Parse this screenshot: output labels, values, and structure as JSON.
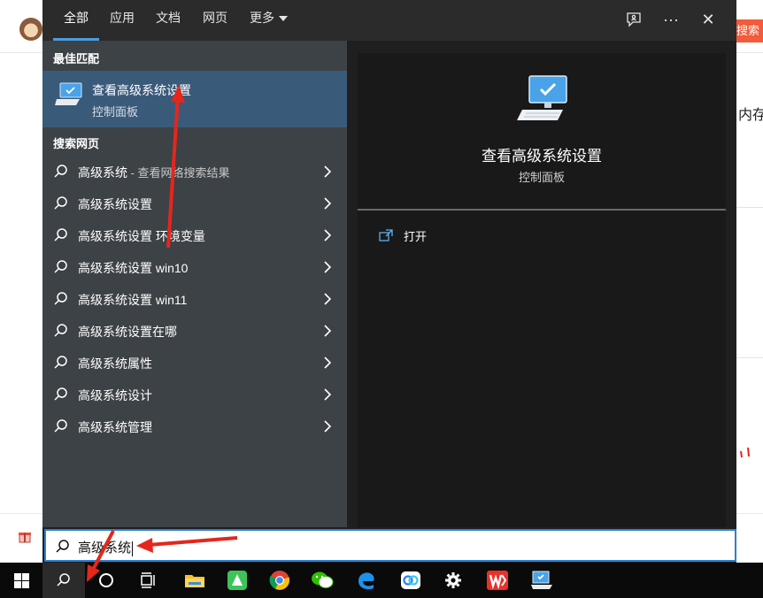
{
  "background_page": {
    "search_button_label": "搜索",
    "side_text": "内存"
  },
  "tabs": [
    {
      "label": "全部",
      "active": true
    },
    {
      "label": "应用"
    },
    {
      "label": "文档"
    },
    {
      "label": "网页"
    },
    {
      "label": "更多"
    }
  ],
  "header_icons": [
    "feedback-icon",
    "more-options-icon",
    "close-icon"
  ],
  "header_ellipsis": "···",
  "header_close": "✕",
  "best_match": {
    "section_label": "最佳匹配",
    "title": "查看高级系统设置",
    "subtitle": "控制面板"
  },
  "web_search": {
    "section_label": "搜索网页",
    "items": [
      {
        "text": "高级系统",
        "suffix": " - 查看网络搜索结果"
      },
      {
        "text": "高级系统设置"
      },
      {
        "text": "高级系统设置 环境变量"
      },
      {
        "text": "高级系统设置 win10"
      },
      {
        "text": "高级系统设置 win11"
      },
      {
        "text": "高级系统设置在哪"
      },
      {
        "text": "高级系统属性"
      },
      {
        "text": "高级系统设计"
      },
      {
        "text": "高级系统管理"
      }
    ]
  },
  "preview": {
    "title": "查看高级系统设置",
    "subtitle": "控制面板",
    "actions": [
      {
        "label": "打开",
        "icon": "open-icon"
      }
    ]
  },
  "search_box": {
    "value": "高级系统"
  },
  "taskbar": {
    "items": [
      "windows-start-icon",
      "search-icon",
      "cortana-icon",
      "task-view-icon",
      "file-explorer-icon",
      "green-app-icon",
      "chrome-icon",
      "wechat-icon",
      "edge-icon",
      "cloud-drive-icon",
      "settings-icon",
      "wps-icon",
      "control-panel-icon"
    ]
  },
  "colors": {
    "accent": "#4a9de0",
    "annotation": "#e5261c",
    "selected": "#3a5a7a"
  }
}
